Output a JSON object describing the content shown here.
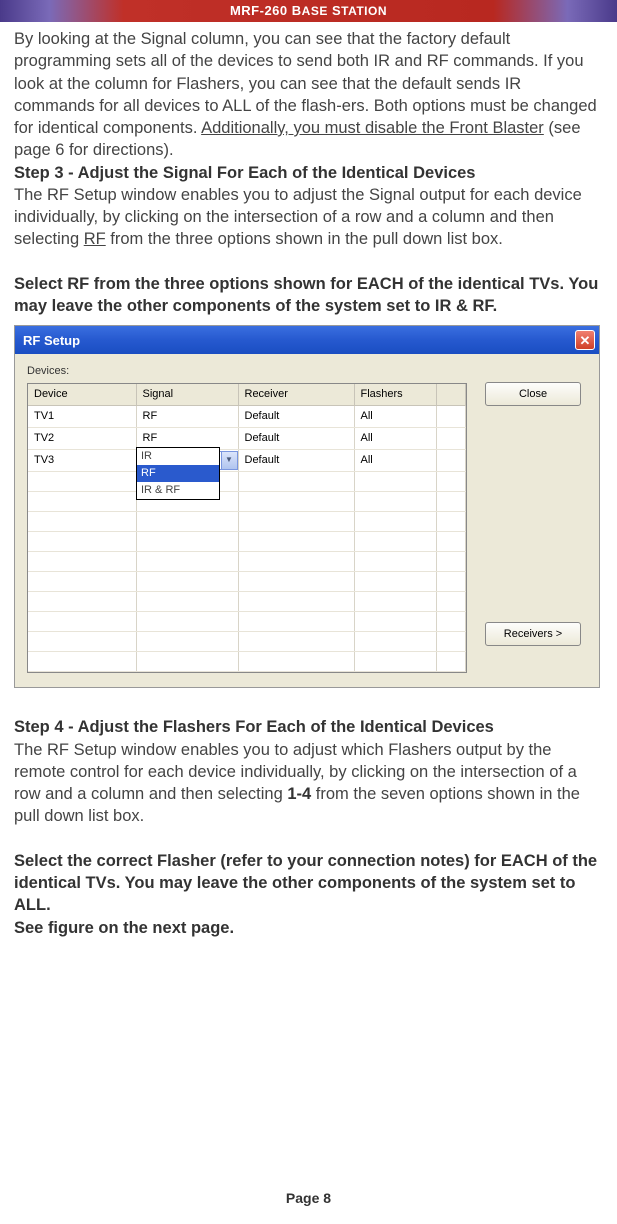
{
  "header": {
    "title_main": "MRF-260 B",
    "title_smallcaps": "ASE",
    "title_mid": " S",
    "title_smallcaps2": "TATION"
  },
  "intro": {
    "p1a": "By looking at the Signal column, you can see that the factory default programming sets all of the devices to send both IR and RF commands.  If you look at the column for Flashers, you can see that the default sends IR commands for all devices to ALL of the flash-ers. Both options must be changed for identical components. ",
    "p1u": "Additionally, you must disable the Front Blaster",
    "p1b": " (see page 6 for directions)."
  },
  "step3": {
    "head": "Step 3 - Adjust the Signal For Each of the Identical Devices",
    "body_a": "The RF Setup window enables you to adjust the Signal output for each device individually, by clicking on the intersection of a row and a column and then selecting ",
    "body_u": "RF",
    "body_b": " from the three options shown in the pull down list box.",
    "bold": "Select RF from the three options shown for EACH of the identical TVs. You may leave the other components of the system set to IR & RF."
  },
  "win": {
    "title": "RF Setup",
    "devices_label": "Devices:",
    "headers": {
      "device": "Device",
      "signal": "Signal",
      "receiver": "Receiver",
      "flashers": "Flashers"
    },
    "rows": [
      {
        "device": "TV1",
        "signal": "RF",
        "receiver": "Default",
        "flashers": "All"
      },
      {
        "device": "TV2",
        "signal": "RF",
        "receiver": "Default",
        "flashers": "All"
      },
      {
        "device": "TV3",
        "signal": "IR & RF",
        "receiver": "Default",
        "flashers": "All"
      }
    ],
    "dropdown": {
      "opt1": "IR",
      "opt2": "RF",
      "opt3": "IR & RF"
    },
    "close_btn": "Close",
    "receivers_btn": "Receivers >",
    "x": "✕"
  },
  "step4": {
    "head": "Step 4 - Adjust the Flashers For Each of the Identical Devices",
    "body_a": "The RF Setup window enables you to adjust which Flashers output by the remote control for each device individually, by clicking on the intersection of a row and a column and then selecting ",
    "body_bold": "1-4",
    "body_b": "  from the seven options shown in the pull down list box.",
    "bold": "Select the correct Flasher (refer to your connection notes) for EACH of the identical TVs. You may leave the other components of the system set to ALL.",
    "fig": "See figure on the next page."
  },
  "page_num": "Page 8"
}
